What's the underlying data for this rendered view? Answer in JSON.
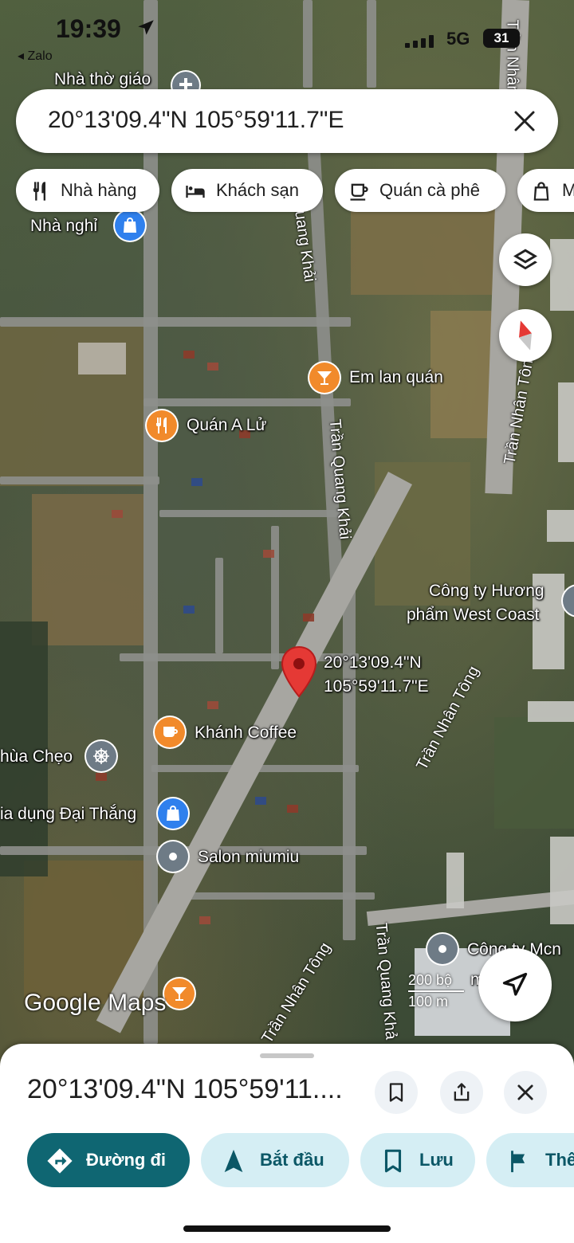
{
  "status_bar": {
    "time": "19:39",
    "back_app": "◂ Zalo",
    "network": "5G",
    "battery": "31"
  },
  "search": {
    "query": "20°13'09.4\"N 105°59'11.7\"E"
  },
  "chips": [
    {
      "label": "Nhà hàng",
      "icon": "fork-knife-icon"
    },
    {
      "label": "Khách sạn",
      "icon": "bed-icon"
    },
    {
      "label": "Quán cà phê",
      "icon": "coffee-cup-icon"
    },
    {
      "label": "M",
      "icon": "shopping-bag-icon"
    }
  ],
  "map": {
    "places": {
      "church": "Nhà thờ giáo",
      "guesthouse": "Nhà nghỉ",
      "em_lan": "Em lan quán",
      "quan_a_lu": "Quán A Lử",
      "cong_ty_huong": "Công ty Hương",
      "pham_west_coast": "phẩm West Coast",
      "pin_line1": "20°13'09.4\"N",
      "pin_line2": "105°59'11.7\"E",
      "khanh_coffee": "Khánh Coffee",
      "chua_cheo": "hùa Chẹo",
      "gia_dung": "ia dụng Đại Thắng",
      "salon": "Salon miumiu",
      "cong_ty_mcn": "Công ty Mcn",
      "fd": "m         d F"
    },
    "streets": {
      "tqk_top": "Quang Khải",
      "tqk_mid": "Trần Quang Khải",
      "tqk_bottom": "Trần Quang Khả",
      "tnt_top": "Trần Nhân",
      "tnt_right": "Trần Nhân Tông",
      "tnt_mid": "Trần Nhân Tông",
      "tnt_bottom": "Trần Nhân Tông"
    },
    "logo": "Google Maps",
    "scale_top": "200 bộ",
    "scale_bottom": "100 m"
  },
  "sheet": {
    "title": "20°13'09.4\"N 105°59'11....",
    "actions": [
      {
        "label": "Đường đi",
        "icon": "directions-icon"
      },
      {
        "label": "Bắt đầu",
        "icon": "navigation-arrow-icon"
      },
      {
        "label": "Lưu",
        "icon": "bookmark-icon"
      },
      {
        "label": "Thê",
        "icon": "flag-icon"
      }
    ]
  },
  "colors": {
    "primary": "#0f6672",
    "pill": "#d5eef4",
    "pin": "#e53935",
    "poi_orange": "#f18a2b",
    "poi_blue": "#2f80ed",
    "poi_gray": "#6e7b86"
  }
}
